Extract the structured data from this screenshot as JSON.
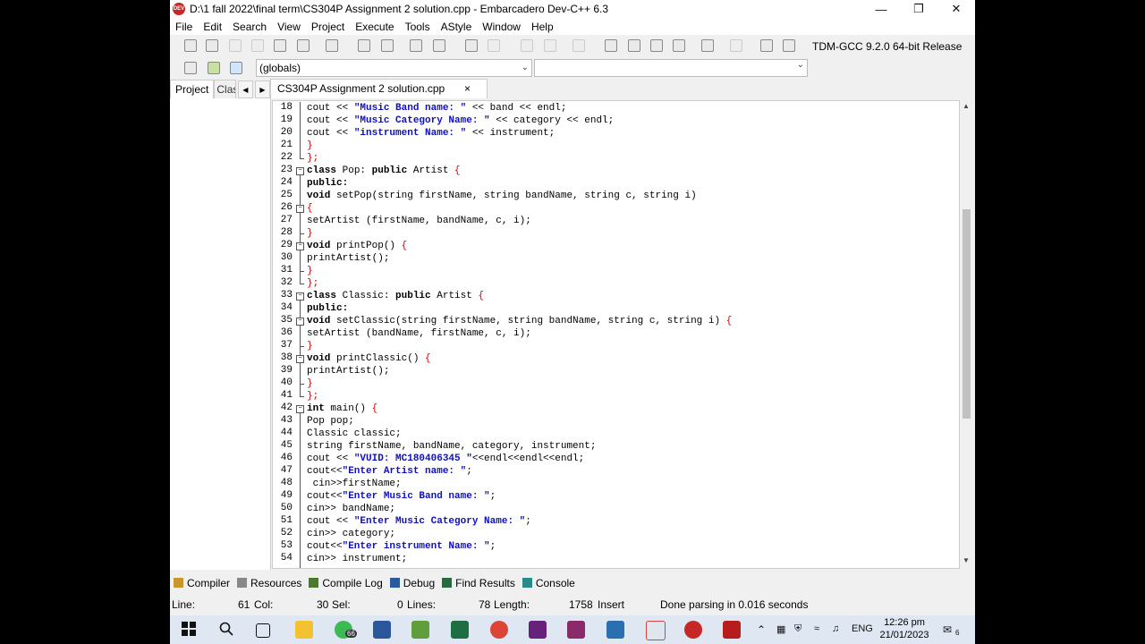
{
  "window": {
    "title": "D:\\1 fall 2022\\final term\\CS304P Assignment 2 solution.cpp - Embarcadero Dev-C++ 6.3",
    "app_icon_text": "DEV"
  },
  "menu": [
    "File",
    "Edit",
    "Search",
    "View",
    "Project",
    "Execute",
    "Tools",
    "AStyle",
    "Window",
    "Help"
  ],
  "toolbar": {
    "compiler": "TDM-GCC 9.2.0 64-bit Release",
    "scope": "(globals)"
  },
  "left_tabs": {
    "project": "Project",
    "classes": "Clas"
  },
  "file_tab": {
    "name": "CS304P Assignment 2 solution.cpp",
    "close": "×"
  },
  "code_lines": [
    {
      "n": "18",
      "segs": [
        [
          "p",
          "cout << "
        ],
        [
          "s",
          "\"Music Band name: \""
        ],
        [
          "p",
          " << band << endl;"
        ]
      ]
    },
    {
      "n": "19",
      "segs": [
        [
          "p",
          "cout << "
        ],
        [
          "s",
          "\"Music Category Name: \""
        ],
        [
          "p",
          " << category << endl;"
        ]
      ]
    },
    {
      "n": "20",
      "segs": [
        [
          "p",
          "cout << "
        ],
        [
          "s",
          "\"instrument Name: \""
        ],
        [
          "p",
          " << instrument;"
        ]
      ]
    },
    {
      "n": "21",
      "segs": [
        [
          "y",
          "}"
        ]
      ]
    },
    {
      "n": "22",
      "segs": [
        [
          "y",
          "};"
        ]
      ]
    },
    {
      "n": "23",
      "segs": [
        [
          "k",
          "class"
        ],
        [
          "p",
          " Pop: "
        ],
        [
          "k",
          "public"
        ],
        [
          "p",
          " Artist "
        ],
        [
          "y",
          "{"
        ]
      ]
    },
    {
      "n": "24",
      "segs": [
        [
          "k",
          "public:"
        ]
      ]
    },
    {
      "n": "25",
      "segs": [
        [
          "k",
          "void"
        ],
        [
          "p",
          " setPop(string firstName, string bandName, string c, string i)"
        ]
      ]
    },
    {
      "n": "26",
      "segs": [
        [
          "y",
          "{"
        ]
      ]
    },
    {
      "n": "27",
      "segs": [
        [
          "p",
          "setArtist (firstName, bandName, c, i);"
        ]
      ]
    },
    {
      "n": "28",
      "segs": [
        [
          "y",
          "}"
        ]
      ]
    },
    {
      "n": "29",
      "segs": [
        [
          "k",
          "void"
        ],
        [
          "p",
          " printPop() "
        ],
        [
          "y",
          "{"
        ]
      ]
    },
    {
      "n": "30",
      "segs": [
        [
          "p",
          "printArtist();"
        ]
      ]
    },
    {
      "n": "31",
      "segs": [
        [
          "y",
          "}"
        ]
      ]
    },
    {
      "n": "32",
      "segs": [
        [
          "y",
          "};"
        ]
      ]
    },
    {
      "n": "33",
      "segs": [
        [
          "k",
          "class"
        ],
        [
          "p",
          " Classic: "
        ],
        [
          "k",
          "public"
        ],
        [
          "p",
          " Artist "
        ],
        [
          "y",
          "{"
        ]
      ]
    },
    {
      "n": "34",
      "segs": [
        [
          "k",
          "public:"
        ]
      ]
    },
    {
      "n": "35",
      "segs": [
        [
          "k",
          "void"
        ],
        [
          "p",
          " setClassic(string firstName, string bandName, string c, string i) "
        ],
        [
          "y",
          "{"
        ]
      ]
    },
    {
      "n": "36",
      "segs": [
        [
          "p",
          "setArtist (bandName, firstName, c, i);"
        ]
      ]
    },
    {
      "n": "37",
      "segs": [
        [
          "y",
          "}"
        ]
      ]
    },
    {
      "n": "38",
      "segs": [
        [
          "k",
          "void"
        ],
        [
          "p",
          " printClassic() "
        ],
        [
          "y",
          "{"
        ]
      ]
    },
    {
      "n": "39",
      "segs": [
        [
          "p",
          "printArtist();"
        ]
      ]
    },
    {
      "n": "40",
      "segs": [
        [
          "y",
          "}"
        ]
      ]
    },
    {
      "n": "41",
      "segs": [
        [
          "y",
          "};"
        ]
      ]
    },
    {
      "n": "42",
      "segs": [
        [
          "k",
          "int"
        ],
        [
          "p",
          " main() "
        ],
        [
          "y",
          "{"
        ]
      ]
    },
    {
      "n": "43",
      "segs": [
        [
          "p",
          "Pop pop;"
        ]
      ]
    },
    {
      "n": "44",
      "segs": [
        [
          "p",
          "Classic classic;"
        ]
      ]
    },
    {
      "n": "45",
      "segs": [
        [
          "p",
          "string firstName, bandName, category, instrument;"
        ]
      ]
    },
    {
      "n": "46",
      "segs": [
        [
          "p",
          "cout << "
        ],
        [
          "s",
          "\"VUID: MC180406345 \""
        ],
        [
          "p",
          "<<endl<<endl<<endl;"
        ]
      ]
    },
    {
      "n": "47",
      "segs": [
        [
          "p",
          "cout<<"
        ],
        [
          "s",
          "\"Enter Artist name: \""
        ],
        [
          "p",
          ";"
        ]
      ]
    },
    {
      "n": "48",
      "segs": [
        [
          "p",
          " cin>>firstName;"
        ]
      ]
    },
    {
      "n": "49",
      "segs": [
        [
          "p",
          "cout<<"
        ],
        [
          "s",
          "\"Enter Music Band name: \""
        ],
        [
          "p",
          ";"
        ]
      ]
    },
    {
      "n": "50",
      "segs": [
        [
          "p",
          "cin>> bandName;"
        ]
      ]
    },
    {
      "n": "51",
      "segs": [
        [
          "p",
          "cout << "
        ],
        [
          "s",
          "\"Enter Music Category Name: \""
        ],
        [
          "p",
          ";"
        ]
      ]
    },
    {
      "n": "52",
      "segs": [
        [
          "p",
          "cin>> category;"
        ]
      ]
    },
    {
      "n": "53",
      "segs": [
        [
          "p",
          "cout<<"
        ],
        [
          "s",
          "\"Enter instrument Name: \""
        ],
        [
          "p",
          ";"
        ]
      ]
    },
    {
      "n": "54",
      "segs": [
        [
          "p",
          "cin>> instrument;"
        ]
      ]
    }
  ],
  "bottom_tabs": [
    {
      "label": "Compiler",
      "icon": "compiler-icon",
      "color": "#c8962a"
    },
    {
      "label": "Resources",
      "icon": "resources-icon",
      "color": "#888888"
    },
    {
      "label": "Compile Log",
      "icon": "compile-log-icon",
      "color": "#4a7a2a"
    },
    {
      "label": "Debug",
      "icon": "debug-icon",
      "color": "#2a5aa0"
    },
    {
      "label": "Find Results",
      "icon": "find-results-icon",
      "color": "#2a6a40"
    },
    {
      "label": "Console",
      "icon": "console-icon",
      "color": "#2a8a8a"
    }
  ],
  "status": {
    "line_label": "Line:",
    "line": "61",
    "col_label": "Col:",
    "col": "30",
    "sel_label": "Sel:",
    "sel": "0",
    "lines_label": "Lines:",
    "lines": "78",
    "length_label": "Length:",
    "length": "1758",
    "mode": "Insert",
    "message": "Done parsing in 0.016 seconds"
  },
  "taskbar": {
    "whatsapp_badge": "66",
    "lang": "ENG",
    "time": "12:26 pm",
    "date": "21/01/2023",
    "notif_count": "6"
  }
}
